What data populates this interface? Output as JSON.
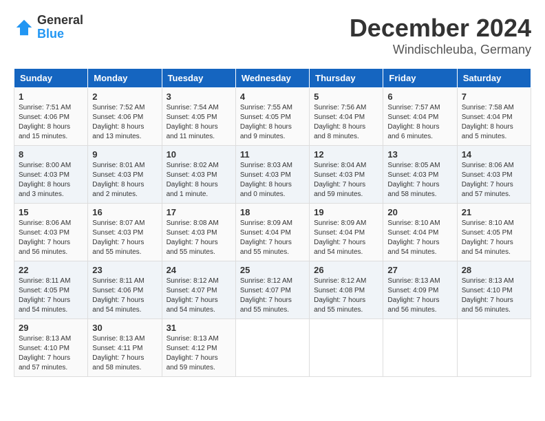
{
  "logo": {
    "general": "General",
    "blue": "Blue"
  },
  "title": "December 2024",
  "subtitle": "Windischleuba, Germany",
  "days": [
    "Sunday",
    "Monday",
    "Tuesday",
    "Wednesday",
    "Thursday",
    "Friday",
    "Saturday"
  ],
  "weeks": [
    [
      {
        "day": "1",
        "sunrise": "7:51 AM",
        "sunset": "4:06 PM",
        "daylight": "8 hours and 15 minutes."
      },
      {
        "day": "2",
        "sunrise": "7:52 AM",
        "sunset": "4:06 PM",
        "daylight": "8 hours and 13 minutes."
      },
      {
        "day": "3",
        "sunrise": "7:54 AM",
        "sunset": "4:05 PM",
        "daylight": "8 hours and 11 minutes."
      },
      {
        "day": "4",
        "sunrise": "7:55 AM",
        "sunset": "4:05 PM",
        "daylight": "8 hours and 9 minutes."
      },
      {
        "day": "5",
        "sunrise": "7:56 AM",
        "sunset": "4:04 PM",
        "daylight": "8 hours and 8 minutes."
      },
      {
        "day": "6",
        "sunrise": "7:57 AM",
        "sunset": "4:04 PM",
        "daylight": "8 hours and 6 minutes."
      },
      {
        "day": "7",
        "sunrise": "7:58 AM",
        "sunset": "4:04 PM",
        "daylight": "8 hours and 5 minutes."
      }
    ],
    [
      {
        "day": "8",
        "sunrise": "8:00 AM",
        "sunset": "4:03 PM",
        "daylight": "8 hours and 3 minutes."
      },
      {
        "day": "9",
        "sunrise": "8:01 AM",
        "sunset": "4:03 PM",
        "daylight": "8 hours and 2 minutes."
      },
      {
        "day": "10",
        "sunrise": "8:02 AM",
        "sunset": "4:03 PM",
        "daylight": "8 hours and 1 minute."
      },
      {
        "day": "11",
        "sunrise": "8:03 AM",
        "sunset": "4:03 PM",
        "daylight": "8 hours and 0 minutes."
      },
      {
        "day": "12",
        "sunrise": "8:04 AM",
        "sunset": "4:03 PM",
        "daylight": "7 hours and 59 minutes."
      },
      {
        "day": "13",
        "sunrise": "8:05 AM",
        "sunset": "4:03 PM",
        "daylight": "7 hours and 58 minutes."
      },
      {
        "day": "14",
        "sunrise": "8:06 AM",
        "sunset": "4:03 PM",
        "daylight": "7 hours and 57 minutes."
      }
    ],
    [
      {
        "day": "15",
        "sunrise": "8:06 AM",
        "sunset": "4:03 PM",
        "daylight": "7 hours and 56 minutes."
      },
      {
        "day": "16",
        "sunrise": "8:07 AM",
        "sunset": "4:03 PM",
        "daylight": "7 hours and 55 minutes."
      },
      {
        "day": "17",
        "sunrise": "8:08 AM",
        "sunset": "4:03 PM",
        "daylight": "7 hours and 55 minutes."
      },
      {
        "day": "18",
        "sunrise": "8:09 AM",
        "sunset": "4:04 PM",
        "daylight": "7 hours and 55 minutes."
      },
      {
        "day": "19",
        "sunrise": "8:09 AM",
        "sunset": "4:04 PM",
        "daylight": "7 hours and 54 minutes."
      },
      {
        "day": "20",
        "sunrise": "8:10 AM",
        "sunset": "4:04 PM",
        "daylight": "7 hours and 54 minutes."
      },
      {
        "day": "21",
        "sunrise": "8:10 AM",
        "sunset": "4:05 PM",
        "daylight": "7 hours and 54 minutes."
      }
    ],
    [
      {
        "day": "22",
        "sunrise": "8:11 AM",
        "sunset": "4:05 PM",
        "daylight": "7 hours and 54 minutes."
      },
      {
        "day": "23",
        "sunrise": "8:11 AM",
        "sunset": "4:06 PM",
        "daylight": "7 hours and 54 minutes."
      },
      {
        "day": "24",
        "sunrise": "8:12 AM",
        "sunset": "4:07 PM",
        "daylight": "7 hours and 54 minutes."
      },
      {
        "day": "25",
        "sunrise": "8:12 AM",
        "sunset": "4:07 PM",
        "daylight": "7 hours and 55 minutes."
      },
      {
        "day": "26",
        "sunrise": "8:12 AM",
        "sunset": "4:08 PM",
        "daylight": "7 hours and 55 minutes."
      },
      {
        "day": "27",
        "sunrise": "8:13 AM",
        "sunset": "4:09 PM",
        "daylight": "7 hours and 56 minutes."
      },
      {
        "day": "28",
        "sunrise": "8:13 AM",
        "sunset": "4:10 PM",
        "daylight": "7 hours and 56 minutes."
      }
    ],
    [
      {
        "day": "29",
        "sunrise": "8:13 AM",
        "sunset": "4:10 PM",
        "daylight": "7 hours and 57 minutes."
      },
      {
        "day": "30",
        "sunrise": "8:13 AM",
        "sunset": "4:11 PM",
        "daylight": "7 hours and 58 minutes."
      },
      {
        "day": "31",
        "sunrise": "8:13 AM",
        "sunset": "4:12 PM",
        "daylight": "7 hours and 59 minutes."
      },
      null,
      null,
      null,
      null
    ]
  ],
  "labels": {
    "sunrise": "Sunrise:",
    "sunset": "Sunset:",
    "daylight": "Daylight:"
  }
}
